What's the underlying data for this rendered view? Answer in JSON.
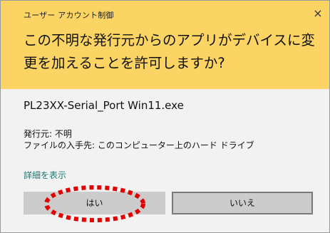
{
  "dialog": {
    "title": "ユーザー アカウント制御",
    "close_glyph": "×",
    "question": "この不明な発行元からのアプリがデバイスに変更を加えることを許可しますか?",
    "file_name": "PL23XX-Serial_Port Win11.exe",
    "publisher_line": "発行元: 不明",
    "origin_line": "ファイルの入手先: このコンピューター上のハード ドライブ",
    "show_details": "詳細を表示",
    "yes_label": "はい",
    "no_label": "いいえ"
  },
  "colors": {
    "header_bg": "#fcd463",
    "body_bg": "#f2f2f2",
    "link": "#1b7a6f",
    "annotation_ring": "#e30000"
  }
}
